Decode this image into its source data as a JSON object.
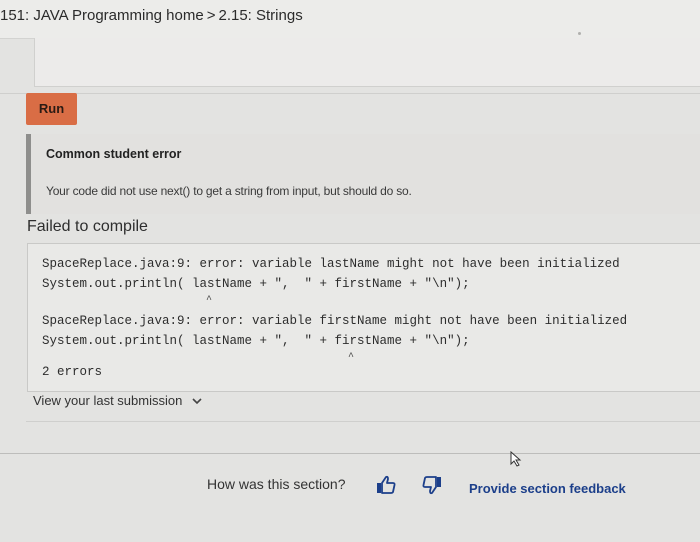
{
  "breadcrumb": {
    "course": "151: JAVA Programming home",
    "separator": ">",
    "section": "2.15: Strings"
  },
  "run_button": {
    "label": "Run"
  },
  "error_panel": {
    "title": "Common student error",
    "message": "Your code did not use next() to get a string from input, but should do so."
  },
  "compile": {
    "heading": "Failed to compile",
    "lines": [
      "SpaceReplace.java:9: error: variable lastName might not have been initialized",
      "System.out.println( lastName + \",  \" + firstName + \"\\n\");",
      "SpaceReplace.java:9: error: variable firstName might not have been initialized",
      "System.out.println( lastName + \",  \" + firstName + \"\\n\");",
      "2 errors"
    ],
    "caret": "^"
  },
  "view_submission": {
    "label": "View your last submission"
  },
  "footer": {
    "question": "How was this section?",
    "feedback_link": "Provide section feedback"
  },
  "icons": {
    "thumbs_up": "thumbs-up-icon",
    "thumbs_down": "thumbs-down-icon",
    "chevron": "chevron-down-icon"
  },
  "colors": {
    "run_button": "#d96d45",
    "link": "#1c3f8a",
    "error_bar": "#8e8e8c"
  }
}
